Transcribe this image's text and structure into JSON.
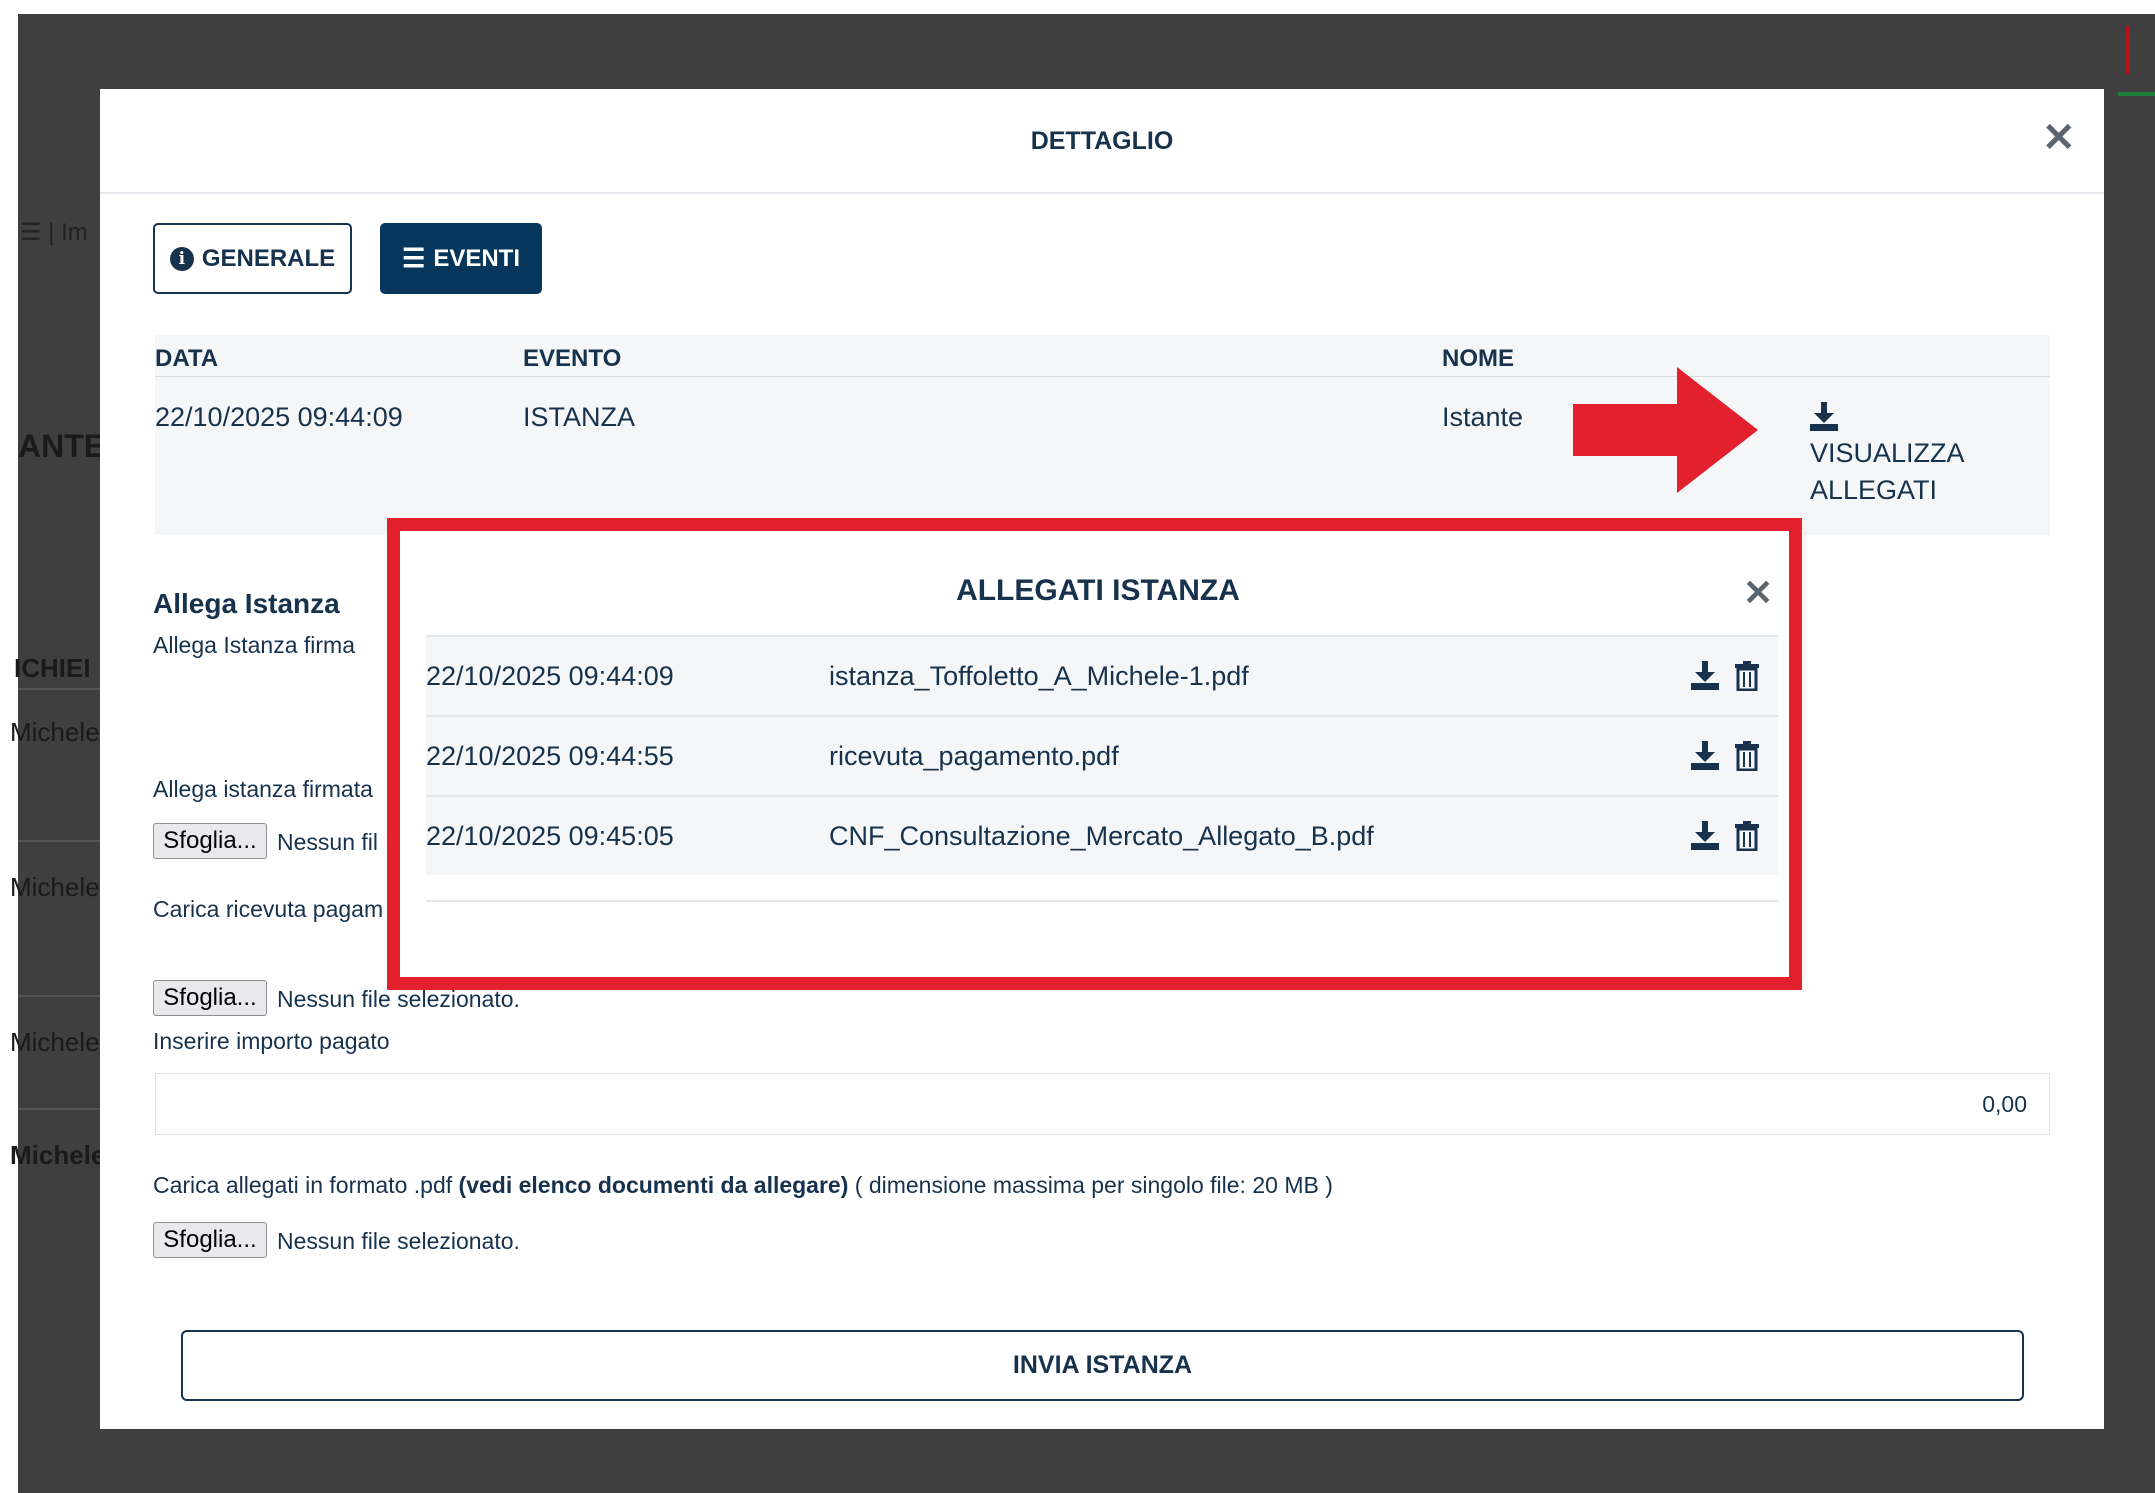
{
  "background": {
    "icon_text": "☰ | Im",
    "label_ante": "ANTE",
    "label_richie": "ICHIEI",
    "rows": [
      "Michele",
      "Michele",
      "Michele",
      "Michele"
    ]
  },
  "modal": {
    "title": "DETTAGLIO",
    "tabs": [
      {
        "label": "GENERALE",
        "icon": "info-circle-icon"
      },
      {
        "label": "EVENTI",
        "icon": "list-icon"
      }
    ],
    "table": {
      "headers": [
        "DATA",
        "EVENTO",
        "NOME"
      ],
      "row": {
        "data": "22/10/2025 09:44:09",
        "evento": "ISTANZA",
        "nome": "Istante",
        "action_line1": "VISUALIZZA",
        "action_line2": "ALLEGATI"
      }
    },
    "allega": {
      "title": "Allega Istanza",
      "subtitle": "Allega Istanza firma",
      "label_firmata": "Allega istanza firmata",
      "label_ricevuta": "Carica ricevuta pagam",
      "file_button": "Sfoglia...",
      "no_file_partial": "Nessun fil",
      "no_file": "Nessun file selezionato.",
      "importo_label": "Inserire importo pagato",
      "importo_value": "0,00",
      "allegati_prefix": "Carica allegati in formato .pdf ",
      "allegati_bold": "(vedi elenco documenti da allegare)",
      "allegati_suffix": " ( dimensione massima per singolo file: 20 MB )"
    },
    "submit_label": "INVIA ISTANZA"
  },
  "inner_modal": {
    "title": "ALLEGATI ISTANZA",
    "rows": [
      {
        "date": "22/10/2025 09:44:09",
        "name": "istanza_Toffoletto_A_Michele-1.pdf"
      },
      {
        "date": "22/10/2025 09:44:55",
        "name": "ricevuta_pagamento.pdf"
      },
      {
        "date": "22/10/2025 09:45:05",
        "name": "CNF_Consultazione_Mercato_Allegato_B.pdf"
      }
    ]
  },
  "colors": {
    "primary": "#17324d",
    "tab_active": "#06365c",
    "highlight": "#e3202e",
    "backdrop": "#3f3f3f"
  }
}
